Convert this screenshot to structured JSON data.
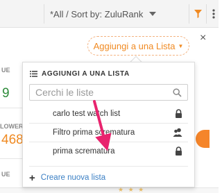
{
  "toolbar": {
    "sort_label": "*All / Sort by: ZuluRank",
    "sort_caret_icon": "caret-down-icon",
    "filter_icon": "funnel-icon",
    "more_icon": "vertical-dots-icon",
    "accent_color": "#f08a22"
  },
  "add_to_list": {
    "trigger_label": "Aggiungi a una Lista",
    "close_label": "×"
  },
  "background": {
    "label_top": "UE",
    "value_top": "9",
    "label_mid": "LOWER",
    "value_mid": "468",
    "label_bottom": "UE"
  },
  "popup": {
    "title": "AGGIUNGI A UNA LISTA",
    "search_placeholder": "Cerchi le liste",
    "items": [
      {
        "label": "carlo test watch list",
        "icon": "lock-icon"
      },
      {
        "label": "Filtro prima scrematura",
        "icon": "users-icon"
      },
      {
        "label": "prima scrematura",
        "icon": "lock-icon"
      }
    ],
    "create_label": "Creare nuova lista",
    "link_color": "#3a7fc4"
  },
  "annotation": {
    "arrow_color": "#e8246e"
  }
}
